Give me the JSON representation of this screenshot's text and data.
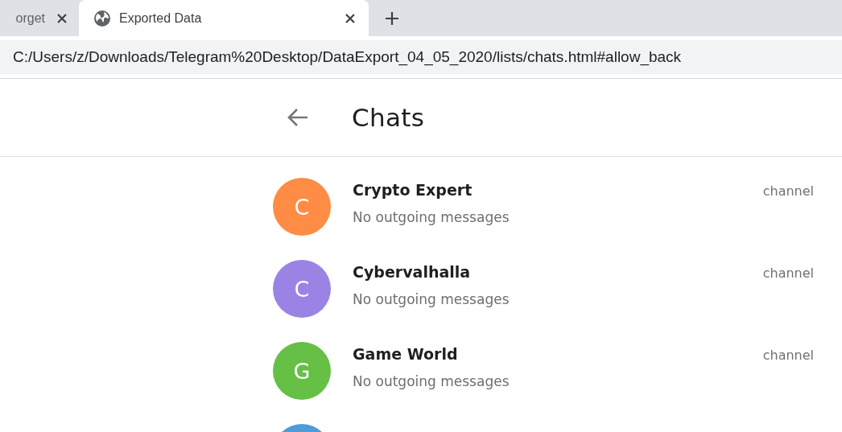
{
  "browser": {
    "tabs": [
      {
        "title": "orget",
        "selected": false
      },
      {
        "title": "Exported Data",
        "selected": true
      }
    ],
    "address": "C:/Users/z/Downloads/Telegram%20Desktop/DataExport_04_05_2020/lists/chats.html#allow_back"
  },
  "page": {
    "title": "Chats"
  },
  "chats": [
    {
      "initial": "C",
      "color": "#ff8c44",
      "name": "Crypto Expert",
      "subtitle": "No outgoing messages",
      "type": "channel"
    },
    {
      "initial": "C",
      "color": "#9b83e6",
      "name": "Cybervalhalla",
      "subtitle": "No outgoing messages",
      "type": "channel"
    },
    {
      "initial": "G",
      "color": "#65c045",
      "name": "Game World",
      "subtitle": "No outgoing messages",
      "type": "channel"
    },
    {
      "color": "#4f9cd9"
    }
  ]
}
